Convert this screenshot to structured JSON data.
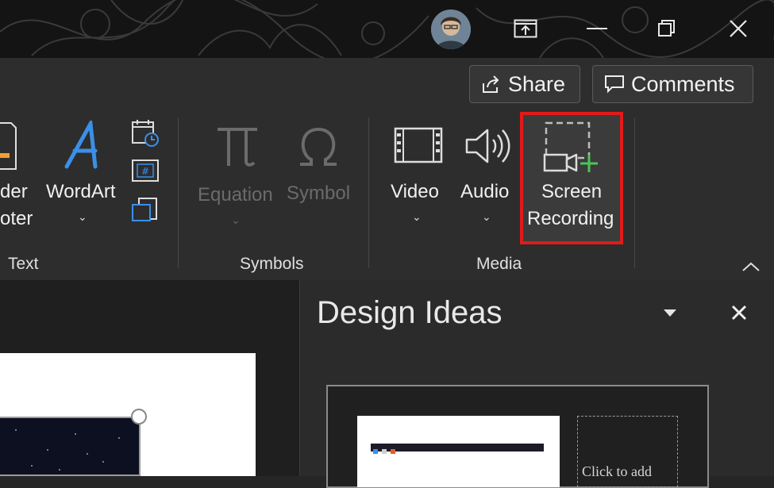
{
  "window": {
    "avatar_icon": "user-avatar",
    "buttons": [
      "present-icon",
      "minimize-icon",
      "restore-icon",
      "close-icon"
    ]
  },
  "header": {
    "share_label": "Share",
    "comments_label": "Comments"
  },
  "ribbon": {
    "text_group": {
      "header_footer_line1": "der",
      "header_footer_line2": "oter",
      "wordart_label": "WordArt",
      "group_label": "Text"
    },
    "symbols_group": {
      "equation_label": "Equation",
      "symbol_label": "Symbol",
      "group_label": "Symbols"
    },
    "media_group": {
      "video_label": "Video",
      "audio_label": "Audio",
      "screen_recording_line1": "Screen",
      "screen_recording_line2": "Recording",
      "group_label": "Media"
    },
    "colors": {
      "highlight": "#e11a1a",
      "wordart_blue": "#3b8fe8",
      "recording_plus": "#4cc35a"
    }
  },
  "design_ideas": {
    "title": "Design Ideas",
    "thumbnail_text": "Click to add"
  }
}
